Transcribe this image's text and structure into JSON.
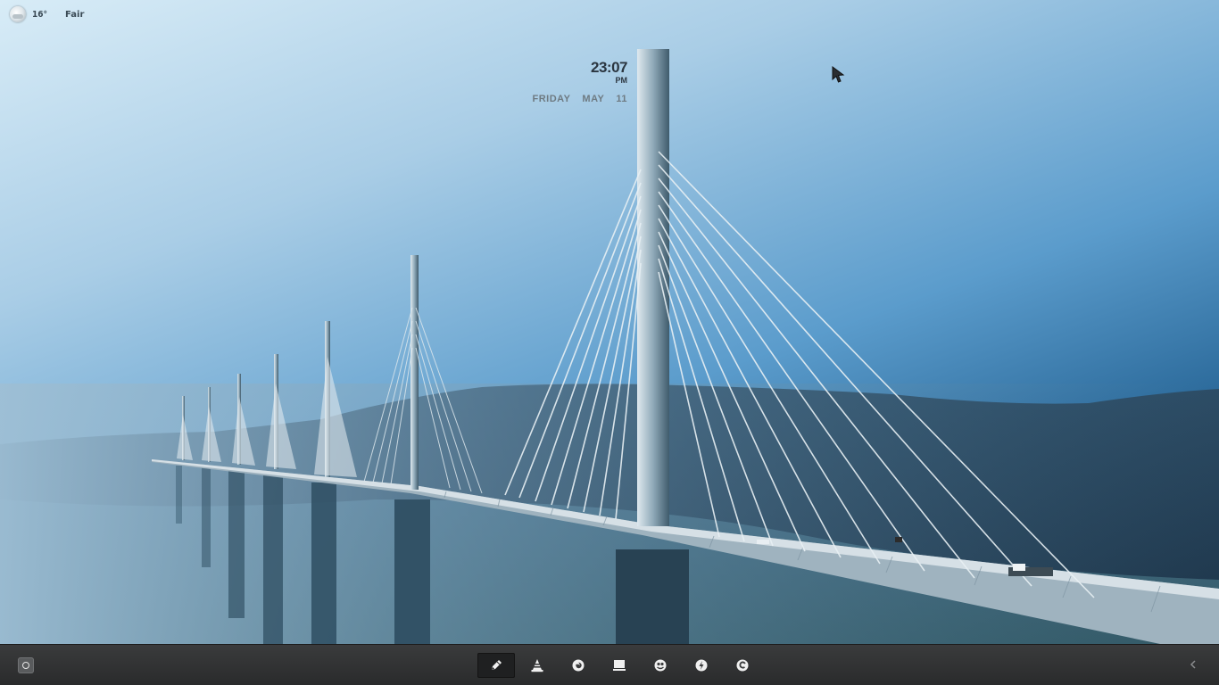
{
  "weather": {
    "temperature": "16°",
    "condition": "Fair",
    "icon": "partly-cloudy-icon"
  },
  "clock": {
    "time": "23:07",
    "period": "PM",
    "weekday": "FRIDAY",
    "month": "MAY",
    "day": "11"
  },
  "taskbar": {
    "start_icon": "start-circle-icon",
    "dock_items": [
      {
        "name": "pencil-app",
        "icon": "pencil-icon",
        "active": true
      },
      {
        "name": "vlc-app",
        "icon": "traffic-cone-icon",
        "active": false
      },
      {
        "name": "firefox-app",
        "icon": "firefox-icon",
        "active": false
      },
      {
        "name": "terminal-app",
        "icon": "monitor-icon",
        "active": false
      },
      {
        "name": "pidgin-app",
        "icon": "chat-icon",
        "active": false
      },
      {
        "name": "power-app",
        "icon": "lightning-icon",
        "active": false
      },
      {
        "name": "swirl-app",
        "icon": "swirl-icon",
        "active": false
      }
    ],
    "tray_icon": "chevron-left-icon"
  },
  "colors": {
    "taskbar": "#2e2f30",
    "sky_top": "#d8ecf7",
    "sky_dark": "#0f3e66",
    "text_dark": "#2b3640"
  }
}
